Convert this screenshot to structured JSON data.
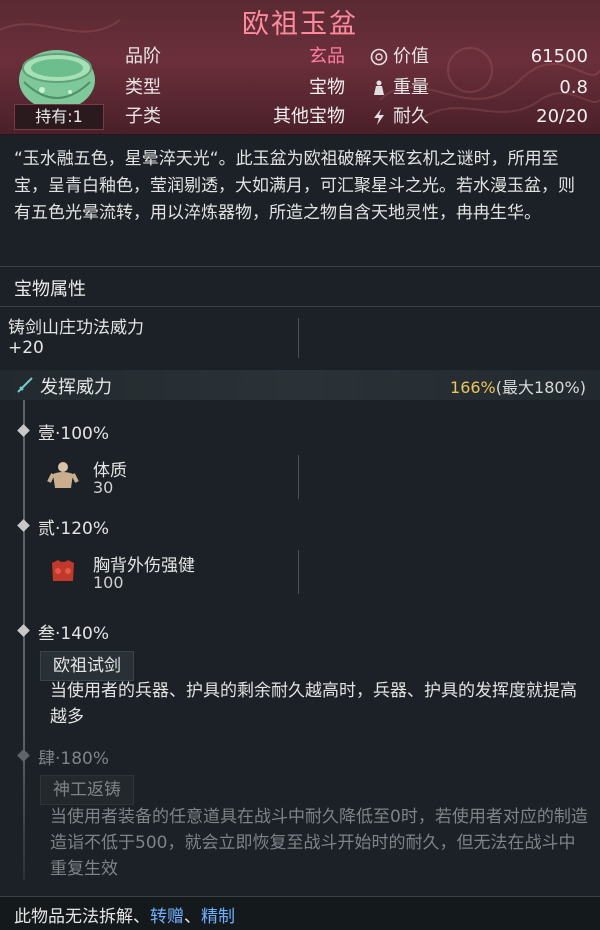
{
  "item": {
    "title": "欧祖玉盆",
    "hold_label": "持有:1"
  },
  "attributes": {
    "grade": {
      "label": "品阶",
      "value": "玄品"
    },
    "type": {
      "label": "类型",
      "value": "宝物"
    },
    "subtype": {
      "label": "子类",
      "value": "其他宝物"
    },
    "price": {
      "label": "价值",
      "value": "61500"
    },
    "weight": {
      "label": "重量",
      "value": "0.8"
    },
    "durability": {
      "label": "耐久",
      "value": "20/20"
    }
  },
  "description": "“玉水融五色，星晕淬天光“。此玉盆为欧祖破解天枢玄机之谜时，所用至宝，呈青白釉色，莹润剔透，大如满月，可汇聚星斗之光。若水漫玉盆，则有五色光晕流转，用以淬炼器物，所造之物自含天地灵性，冉冉生华。",
  "section_title": "宝物属性",
  "bonus": {
    "name": "铸剑山庄功法威力",
    "value": "+20"
  },
  "power": {
    "label": "发挥威力",
    "current": "166%",
    "max_text": "(最大180%)"
  },
  "tiers": [
    {
      "name": "壹",
      "pct": "·100%",
      "skill": "体质",
      "value": "30"
    },
    {
      "name": "贰",
      "pct": "·120%",
      "skill": "胸背外伤强健",
      "value": "100"
    },
    {
      "name": "叁",
      "pct": "·140%",
      "tag": "欧祖试剑",
      "effect": "当使用者的兵器、护具的剩余耐久越高时，兵器、护具的发挥度就提高越多"
    },
    {
      "name": "肆",
      "pct": "·180%",
      "tag": "神工返铸",
      "effect": "当使用者装备的任意道具在战斗中耐久降低至0时，若使用者对应的制造造诣不低于500，就会立即恢复至战斗开始时的耐久，但无法在战斗中重复生效"
    }
  ],
  "footer": {
    "prefix": "此物品无法拆解、",
    "link1": "转赠",
    "sep": "、",
    "link2": "精制"
  },
  "colors": {
    "header_bg": "#6b2f3b",
    "title": "#ff8a9e",
    "rare": "#ff7da0",
    "power_pct": "#e8c85a",
    "link": "#6fb0ff",
    "panel_bg": "#1b2126"
  },
  "icons": {
    "price": "coin-icon",
    "weight": "weight-icon",
    "durability": "lightning-icon",
    "power": "sword-icon",
    "tier1_skill": "body-icon",
    "tier2_skill": "armor-icon"
  }
}
